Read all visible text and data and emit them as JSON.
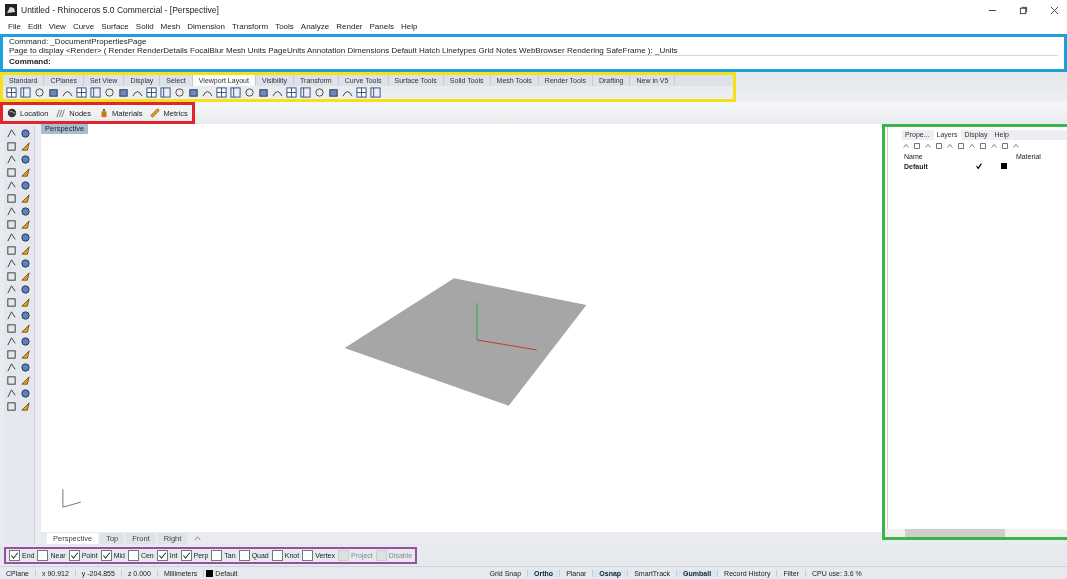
{
  "title_bar": {
    "title": "Untitled - Rhinoceros 5.0 Commercial - [Perspective]"
  },
  "menu": [
    "File",
    "Edit",
    "View",
    "Curve",
    "Surface",
    "Solid",
    "Mesh",
    "Dimension",
    "Transform",
    "Tools",
    "Analyze",
    "Render",
    "Panels",
    "Help"
  ],
  "command_area": {
    "color": "#1ca0dc",
    "lines": [
      "Command: _DocumentPropertiesPage",
      "Page to display <Render> ( Render  RenderDetails  FocalBlur  Mesh  Units  PageUnits  Annotation  Dimensions  Default  Hatch  Linetypes  Grid  Notes  WebBrowser  Rendering  SafeFrame ): _Units"
    ],
    "prompt": "Command:"
  },
  "toolbar": {
    "color": "#f5e11a",
    "tabs": [
      {
        "label": "Standard",
        "selected": false
      },
      {
        "label": "CPlanes",
        "selected": false
      },
      {
        "label": "Set View",
        "selected": false
      },
      {
        "label": "Display",
        "selected": false
      },
      {
        "label": "Select",
        "selected": false
      },
      {
        "label": "Viewport Layout",
        "selected": true
      },
      {
        "label": "Visibility",
        "selected": false
      },
      {
        "label": "Transform",
        "selected": false
      },
      {
        "label": "Curve Tools",
        "selected": false
      },
      {
        "label": "Surface Tools",
        "selected": false
      },
      {
        "label": "Solid Tools",
        "selected": false
      },
      {
        "label": "Mesh Tools",
        "selected": false
      },
      {
        "label": "Render Tools",
        "selected": false
      },
      {
        "label": "Drafting",
        "selected": false
      },
      {
        "label": "New in V5",
        "selected": false
      }
    ]
  },
  "plugin_bar": {
    "color": "#e0262b",
    "items": [
      {
        "label": "Location",
        "kind": "globe"
      },
      {
        "label": "Nodes",
        "kind": "nodes"
      },
      {
        "label": "Materials",
        "kind": "materials"
      },
      {
        "label": "Metrics",
        "kind": "ruler"
      }
    ]
  },
  "viewport": {
    "label": "Perspective",
    "tabs": [
      {
        "label": "Perspective",
        "selected": true
      },
      {
        "label": "Top",
        "selected": false
      },
      {
        "label": "Front",
        "selected": false
      },
      {
        "label": "Right",
        "selected": false
      }
    ]
  },
  "layers_panel": {
    "color": "#3cb44a",
    "tabs": [
      {
        "label": "Prope...",
        "selected": false
      },
      {
        "label": "Layers",
        "selected": true
      },
      {
        "label": "Display",
        "selected": false
      },
      {
        "label": "Help",
        "selected": false
      }
    ],
    "columns": [
      "Name",
      "Material"
    ],
    "rows": [
      {
        "name": "Default",
        "current": true,
        "color": "#000000"
      }
    ]
  },
  "osnaps": {
    "color": "#9c4f9e",
    "items": [
      {
        "label": "End",
        "checked": true,
        "disabled": false
      },
      {
        "label": "Near",
        "checked": false,
        "disabled": false
      },
      {
        "label": "Point",
        "checked": true,
        "disabled": false
      },
      {
        "label": "Mid",
        "checked": true,
        "disabled": false
      },
      {
        "label": "Cen",
        "checked": false,
        "disabled": false
      },
      {
        "label": "Int",
        "checked": true,
        "disabled": false
      },
      {
        "label": "Perp",
        "checked": true,
        "disabled": false
      },
      {
        "label": "Tan",
        "checked": false,
        "disabled": false
      },
      {
        "label": "Quad",
        "checked": false,
        "disabled": false
      },
      {
        "label": "Knot",
        "checked": false,
        "disabled": false
      },
      {
        "label": "Vertex",
        "checked": false,
        "disabled": false
      },
      {
        "label": "Project",
        "checked": false,
        "disabled": true
      },
      {
        "label": "Disable",
        "checked": false,
        "disabled": true
      }
    ]
  },
  "status_bar": {
    "cells": [
      "CPlane",
      "x 90.912",
      "y -204.855",
      "z 0.000",
      "Millimeters"
    ],
    "layer": {
      "label": "Default",
      "color": "#000000"
    },
    "toggles": [
      {
        "label": "Grid Snap",
        "on": false
      },
      {
        "label": "Ortho",
        "on": true
      },
      {
        "label": "Planar",
        "on": false
      },
      {
        "label": "Osnap",
        "on": true
      },
      {
        "label": "SmartTrack",
        "on": false
      },
      {
        "label": "Gumball",
        "on": true
      },
      {
        "label": "Record History",
        "on": false
      }
    ],
    "filter": "Filter",
    "cpu": "CPU use: 3.6 %"
  }
}
